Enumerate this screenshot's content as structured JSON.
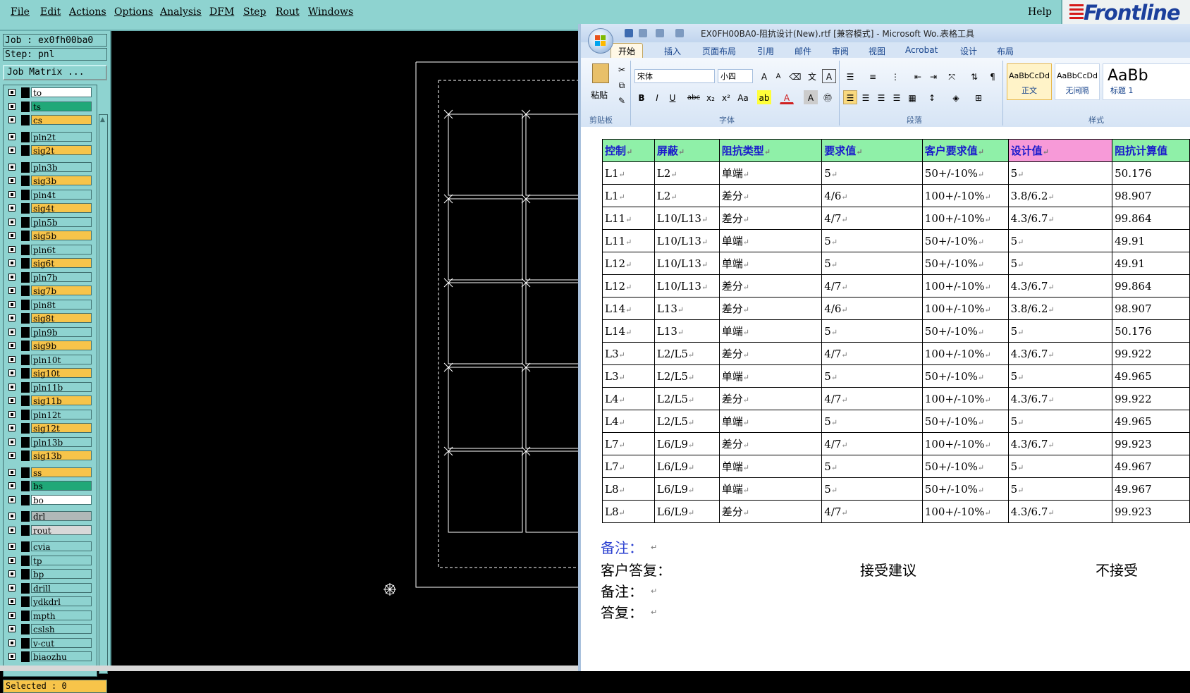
{
  "menubar": {
    "items": [
      "File",
      "Edit",
      "Actions",
      "Options",
      "Analysis",
      "DFM",
      "Step",
      "Rout",
      "Windows"
    ],
    "help": "Help",
    "brand": "Frontline"
  },
  "left_panel": {
    "job": "Job : ex0fh00ba0",
    "step": "Step: pnl",
    "job_matrix": "Job Matrix ...",
    "layers": [
      {
        "name": "to",
        "color": "#ffffff"
      },
      {
        "name": "ts",
        "color": "#20a878"
      },
      {
        "name": "cs",
        "color": "#f7c44a"
      },
      {
        "name": "pln2t",
        "color": "#8ed3d0"
      },
      {
        "name": "sig2t",
        "color": "#f7c44a"
      },
      {
        "name": "pln3b",
        "color": "#8ed3d0"
      },
      {
        "name": "sig3b",
        "color": "#f7c44a"
      },
      {
        "name": "pln4t",
        "color": "#8ed3d0"
      },
      {
        "name": "sig4t",
        "color": "#f7c44a"
      },
      {
        "name": "pln5b",
        "color": "#8ed3d0"
      },
      {
        "name": "sig5b",
        "color": "#f7c44a"
      },
      {
        "name": "pln6t",
        "color": "#8ed3d0"
      },
      {
        "name": "sig6t",
        "color": "#f7c44a"
      },
      {
        "name": "pln7b",
        "color": "#8ed3d0"
      },
      {
        "name": "sig7b",
        "color": "#f7c44a"
      },
      {
        "name": "pln8t",
        "color": "#8ed3d0"
      },
      {
        "name": "sig8t",
        "color": "#f7c44a"
      },
      {
        "name": "pln9b",
        "color": "#8ed3d0"
      },
      {
        "name": "sig9b",
        "color": "#f7c44a"
      },
      {
        "name": "pln10t",
        "color": "#8ed3d0"
      },
      {
        "name": "sig10t",
        "color": "#f7c44a"
      },
      {
        "name": "pln11b",
        "color": "#8ed3d0"
      },
      {
        "name": "sig11b",
        "color": "#f7c44a"
      },
      {
        "name": "pln12t",
        "color": "#8ed3d0"
      },
      {
        "name": "sig12t",
        "color": "#f7c44a"
      },
      {
        "name": "pln13b",
        "color": "#8ed3d0"
      },
      {
        "name": "sig13b",
        "color": "#f7c44a"
      },
      {
        "name": "ss",
        "color": "#f7c44a"
      },
      {
        "name": "bs",
        "color": "#20a878"
      },
      {
        "name": "bo",
        "color": "#ffffff"
      },
      {
        "name": "drl",
        "color": "#b0b8b8"
      },
      {
        "name": "rout",
        "color": "#d8d8d8"
      },
      {
        "name": "cvia",
        "color": "#8ed3d0"
      },
      {
        "name": "tp",
        "color": "#8ed3d0"
      },
      {
        "name": "bp",
        "color": "#8ed3d0"
      },
      {
        "name": "drill",
        "color": "#8ed3d0"
      },
      {
        "name": "ydkdrl",
        "color": "#8ed3d0"
      },
      {
        "name": "mpth",
        "color": "#8ed3d0"
      },
      {
        "name": "cslsh",
        "color": "#8ed3d0"
      },
      {
        "name": "v-cut",
        "color": "#8ed3d0"
      },
      {
        "name": "biaozhu",
        "color": "#8ed3d0"
      }
    ],
    "selected": "Selected : 0"
  },
  "word": {
    "title": "EX0FH00BA0-阻抗设计(New).rtf [兼容模式] - Microsoft Wo...",
    "tools_title": "表格工具",
    "tabs": [
      "开始",
      "插入",
      "页面布局",
      "引用",
      "邮件",
      "审阅",
      "视图",
      "Acrobat",
      "设计",
      "布局"
    ],
    "ribbon": {
      "paste": "粘贴",
      "font_name": "宋体",
      "font_size": "小四",
      "group_clipboard": "剪贴板",
      "group_font": "字体",
      "group_paragraph": "段落",
      "group_styles": "样式",
      "styles": [
        {
          "sample": "AaBbCcDd",
          "name": "正文"
        },
        {
          "sample": "AaBbCcDd",
          "name": "无间隔"
        },
        {
          "sample": "AaBb",
          "name": "标题 1"
        }
      ]
    },
    "table": {
      "headers": [
        "控制",
        "屏蔽",
        "阻抗类型",
        "要求值",
        "客户要求值",
        "设计值",
        "阻抗计算值"
      ],
      "rows": [
        [
          "L1",
          "L2",
          "单端",
          "5",
          "50+/-10%",
          "5",
          "50.176"
        ],
        [
          "L1",
          "L2",
          "差分",
          "4/6",
          "100+/-10%",
          "3.8/6.2",
          "98.907"
        ],
        [
          "L11",
          "L10/L13",
          "差分",
          "4/7",
          "100+/-10%",
          "4.3/6.7",
          "99.864"
        ],
        [
          "L11",
          "L10/L13",
          "单端",
          "5",
          "50+/-10%",
          "5",
          "49.91"
        ],
        [
          "L12",
          "L10/L13",
          "单端",
          "5",
          "50+/-10%",
          "5",
          "49.91"
        ],
        [
          "L12",
          "L10/L13",
          "差分",
          "4/7",
          "100+/-10%",
          "4.3/6.7",
          "99.864"
        ],
        [
          "L14",
          "L13",
          "差分",
          "4/6",
          "100+/-10%",
          "3.8/6.2",
          "98.907"
        ],
        [
          "L14",
          "L13",
          "单端",
          "5",
          "50+/-10%",
          "5",
          "50.176"
        ],
        [
          "L3",
          "L2/L5",
          "差分",
          "4/7",
          "100+/-10%",
          "4.3/6.7",
          "99.922"
        ],
        [
          "L3",
          "L2/L5",
          "单端",
          "5",
          "50+/-10%",
          "5",
          "49.965"
        ],
        [
          "L4",
          "L2/L5",
          "差分",
          "4/7",
          "100+/-10%",
          "4.3/6.7",
          "99.922"
        ],
        [
          "L4",
          "L2/L5",
          "单端",
          "5",
          "50+/-10%",
          "5",
          "49.965"
        ],
        [
          "L7",
          "L6/L9",
          "差分",
          "4/7",
          "100+/-10%",
          "4.3/6.7",
          "99.923"
        ],
        [
          "L7",
          "L6/L9",
          "单端",
          "5",
          "50+/-10%",
          "5",
          "49.967"
        ],
        [
          "L8",
          "L6/L9",
          "单端",
          "5",
          "50+/-10%",
          "5",
          "49.967"
        ],
        [
          "L8",
          "L6/L9",
          "差分",
          "4/7",
          "100+/-10%",
          "4.3/6.7",
          "99.923"
        ]
      ]
    },
    "notes": {
      "remark1": "备注：",
      "customer_reply": "客户答复：",
      "accept": "接受建议",
      "reject": "不接受",
      "remark2": "备注：",
      "reply": "答复："
    }
  }
}
